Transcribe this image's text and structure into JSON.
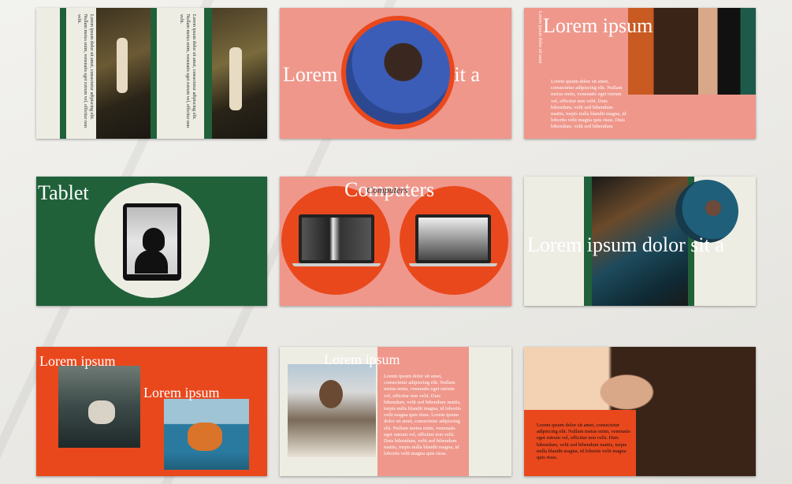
{
  "colors": {
    "pink": "#ef978b",
    "green": "#20613a",
    "orange": "#e9481d",
    "cream": "#eeede4",
    "peach": "#f2d2b3"
  },
  "lorem_long": "Lorem ipsum dolor sit amet, consectetur adipiscing elit. Lorem ipsum dolor sit amet, consectetur adipiscing elit.",
  "slide1": {
    "text_a": "Lorem ipsum dolor sit amet, consectetur adipiscing elit. Nullam metus enim, venenatis eget rutrum vel, efficitur non velit.",
    "text_b": "Lorem ipsum dolor sit amet, consectetur adipiscing elit. Nullam metus enim, venenatis eget rutrum vel, efficitur non velit."
  },
  "slide2": {
    "heading": "Lorem ipsum dolor sit a"
  },
  "slide3": {
    "heading": "Lorem ipsum",
    "side_text": "Lorem ipsum dolor sit amet",
    "para": "Lorem ipsum dolor sit amet, consectetur adipiscing elit. Nullam metus enim, venenatis eget rutrum vel, efficitur non velit. Duis bibendum, velit sed bibendum mattis, turpis nulla blandit magna, id lobortis velit magna quis risus. Duis bibendum, velit sed bibendum mattis, turpis nulla blandit magna, id lobortis velit magna quis risus."
  },
  "slide4": {
    "heading": "Tablet"
  },
  "slide5": {
    "heading": "Computers",
    "subheading": "Computers"
  },
  "slide6": {
    "heading": "Lorem ipsum dolor sit a"
  },
  "slide7": {
    "heading_a": "Lorem ipsum",
    "heading_b": "Lorem ipsum"
  },
  "slide8": {
    "heading": "Lorem ipsum",
    "para": "Lorem ipsum dolor sit amet, consectetur adipiscing elit. Nullam metus enim, venenatis eget rutrum vel, efficitur non velit. Duis bibendum, velit sed bibendum mattis, turpis nulla blandit magna, id lobortis velit magna quis risus. Lorem ipsum dolor sit amet, consectetur adipiscing elit. Nullam metus enim, venenatis eget rutrum vel, efficitur non velit. Duis bibendum, velit sed bibendum mattis, turpis nulla blandit magna, id lobortis velit magna quis risus."
  },
  "slide9": {
    "para": "Lorem ipsum dolor sit amet, consectetur adipiscing elit. Nullam metus enim, venenatis eget rutrum vel, efficitur non velit. Duis bibendum, velit sed bibendum mattis, turpis nulla blandit magna, id lobortis velit magna quis risus."
  }
}
